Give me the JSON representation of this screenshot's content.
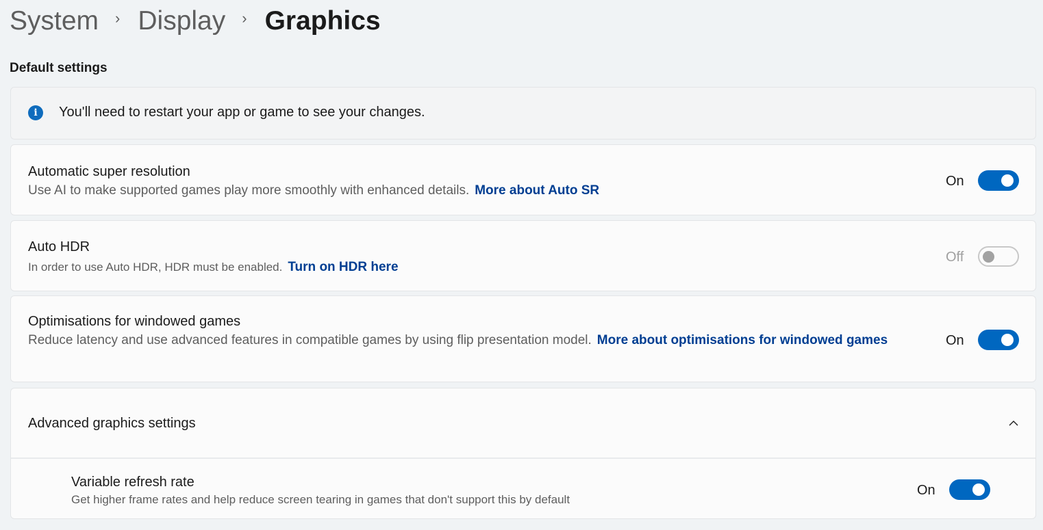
{
  "breadcrumb": [
    {
      "label": "System"
    },
    {
      "label": "Display"
    },
    {
      "label": "Graphics"
    }
  ],
  "breadcrumb_separator": "›",
  "section_title": "Default settings",
  "info_banner": {
    "icon": "info-icon",
    "icon_glyph": "i",
    "text": "You'll need to restart your app or game to see your changes."
  },
  "settings": [
    {
      "title": "Automatic super resolution",
      "description": "Use AI to make supported games play more smoothly with enhanced details.",
      "link": "More about Auto SR",
      "state_label": "On",
      "enabled": true
    },
    {
      "title": "Auto HDR",
      "description": "In order to use Auto HDR, HDR must be enabled.",
      "link": "Turn on HDR here",
      "state_label": "Off",
      "enabled": false
    },
    {
      "title": "Optimisations for windowed games",
      "description": "Reduce latency and use advanced features in compatible games by using flip presentation model.",
      "link": "More about optimisations for windowed games",
      "state_label": "On",
      "enabled": true
    }
  ],
  "advanced": {
    "title": "Advanced graphics settings",
    "expanded": true,
    "items": [
      {
        "title": "Variable refresh rate",
        "description": "Get higher frame rates and help reduce screen tearing in games that don't support this by default",
        "state_label": "On",
        "enabled": true
      }
    ]
  },
  "colors": {
    "accent": "#0067c0",
    "link": "#003e92",
    "background": "#f0f3f5"
  }
}
